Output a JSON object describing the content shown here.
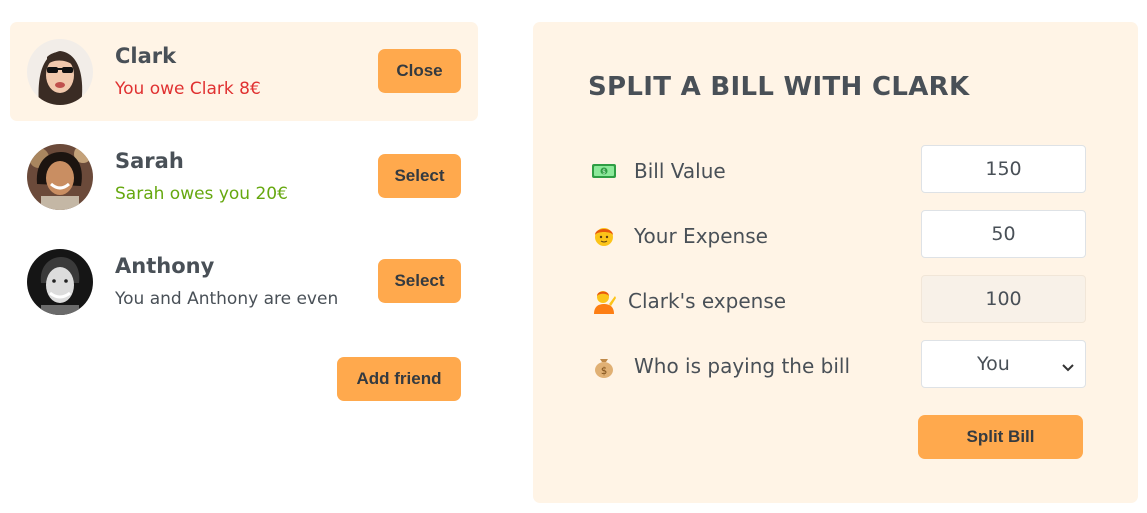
{
  "friends": [
    {
      "name": "Clark",
      "status": "You owe Clark 8€",
      "status_type": "red",
      "button": "Close",
      "selected": true
    },
    {
      "name": "Sarah",
      "status": "Sarah owes you 20€",
      "status_type": "green",
      "button": "Select",
      "selected": false
    },
    {
      "name": "Anthony",
      "status": "You and Anthony are even",
      "status_type": "neutral",
      "button": "Select",
      "selected": false
    }
  ],
  "add_friend_label": "Add friend",
  "split_form": {
    "title": "Split a bill with Clark",
    "bill_value": {
      "label": "Bill Value",
      "value": "150",
      "icon": "money-icon"
    },
    "your_expense": {
      "label": "Your Expense",
      "value": "50",
      "icon": "person-icon"
    },
    "friend_expense": {
      "label": "Clark's expense",
      "value": "100",
      "icon": "person-tipping-hand-icon"
    },
    "payer": {
      "label": "Who is paying the bill",
      "value": "You",
      "icon": "money-bag-icon"
    },
    "submit_label": "Split Bill"
  },
  "colors": {
    "accent": "#ffa94d",
    "panel_bg": "#fff4e6",
    "owe": "#e03131",
    "owed": "#66a80f",
    "text": "#495057"
  }
}
